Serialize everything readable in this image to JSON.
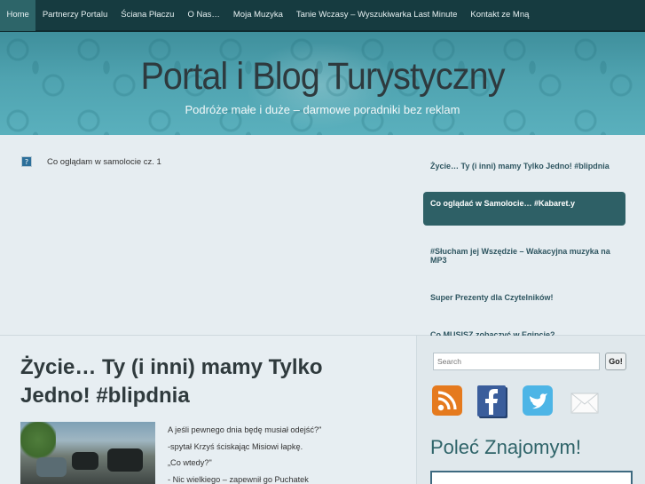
{
  "nav": {
    "items": [
      {
        "label": "Home",
        "active": true
      },
      {
        "label": "Partnerzy Portalu"
      },
      {
        "label": "Ściana Płaczu"
      },
      {
        "label": "O Nas…"
      },
      {
        "label": "Moja Muzyka"
      },
      {
        "label": "Tanie Wczasy – Wyszukiwarka Last Minute"
      },
      {
        "label": "Kontakt ze Mną"
      }
    ]
  },
  "header": {
    "title": "Portal i Blog Turystyczny",
    "tagline": "Podróże małe i duże – darmowe poradniki bez reklam"
  },
  "featured": {
    "video_title": "Co oglądam w samolocie cz. 1",
    "list": [
      {
        "label": "Życie… Ty (i inni) mamy Tylko Jedno! #blipdnia"
      },
      {
        "label": "Co oglądać w Samolocie… #Kabaret.y",
        "active": true
      },
      {
        "label": "#Słucham jej Wszędzie – Wakacyjna muzyka na MP3"
      },
      {
        "label": "Super Prezenty dla Czytelników!"
      },
      {
        "label": "Co MUSISZ zobaczyć w Egipcie?"
      }
    ]
  },
  "post": {
    "title": "Życie… Ty (i inni) mamy Tylko Jedno! #blipdnia",
    "lines": [
      "A jeśli pewnego dnia będę musiał odejść?\"",
      "-spytał Krzyś ściskając Misiowi łapkę.",
      "„Co wtedy?\"",
      "- Nic wielkiego – zapewnił go Puchatek"
    ]
  },
  "sidebar": {
    "search_placeholder": "Search",
    "go_label": "Go!",
    "social_icons": [
      "rss-icon",
      "facebook-icon",
      "twitter-icon",
      "mail-icon"
    ],
    "recommend_title": "Poleć Znajomym!"
  },
  "colors": {
    "nav_bg": "#163b40",
    "nav_active": "#2d6569",
    "banner_teal": "#4fa3b0",
    "accent": "#2e6066",
    "link": "#2f5661"
  }
}
